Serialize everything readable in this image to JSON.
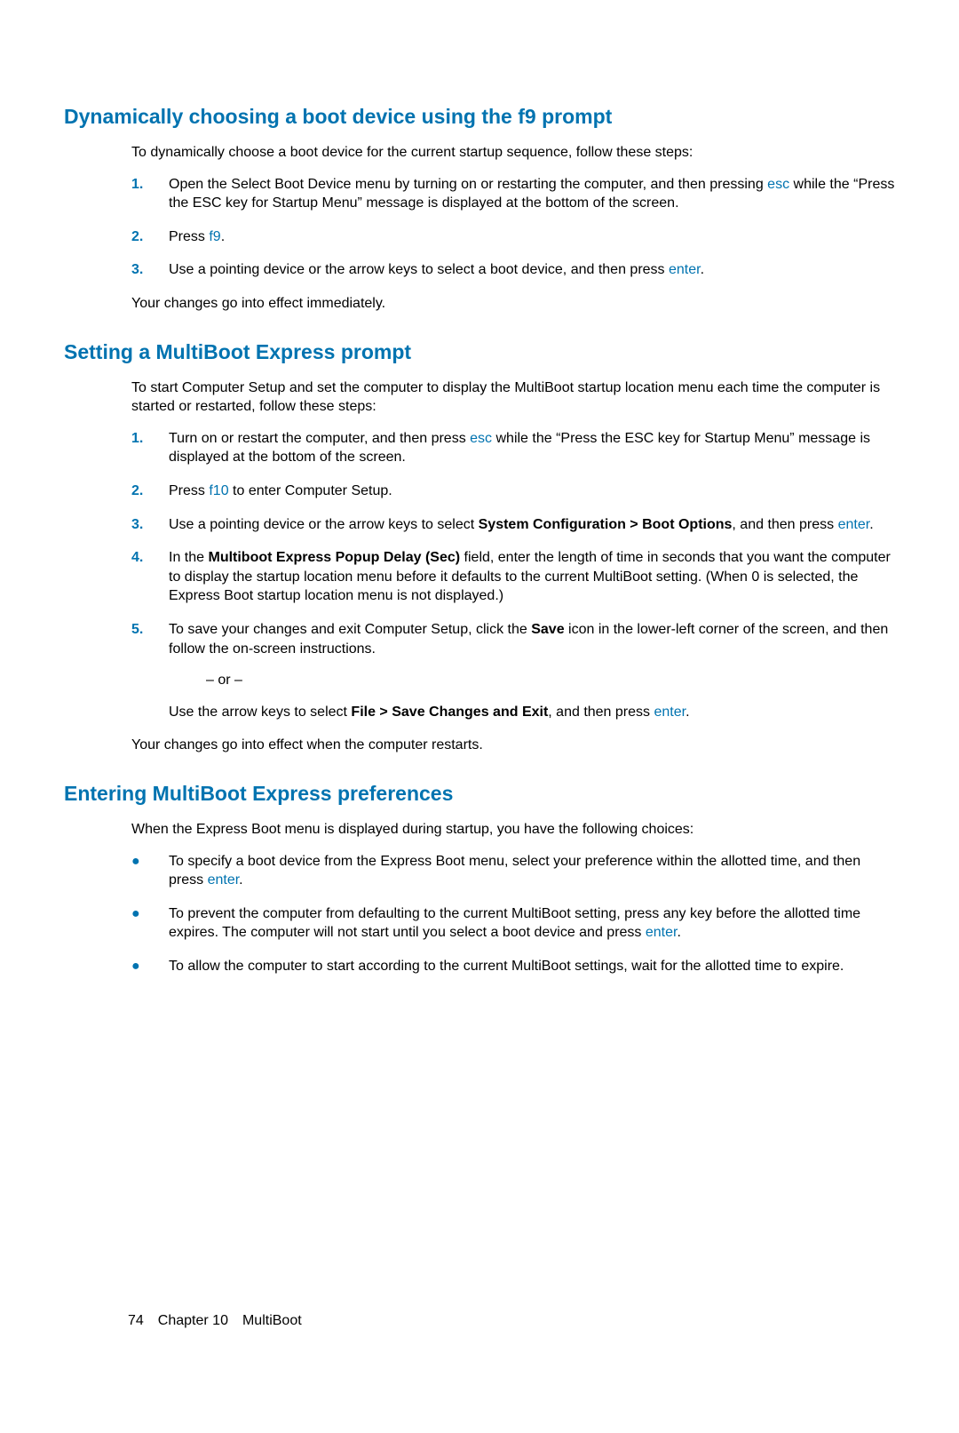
{
  "sections": {
    "s1": {
      "heading": "Dynamically choosing a boot device using the f9 prompt",
      "intro": "To dynamically choose a boot device for the current startup sequence, follow these steps:",
      "step1_a": "Open the Select Boot Device menu by turning on or restarting the computer, and then pressing ",
      "step1_key": "esc",
      "step1_b": " while the “Press the ESC key for Startup Menu” message is displayed at the bottom of the screen.",
      "step2_a": "Press ",
      "step2_key": "f9",
      "step2_b": ".",
      "step3_a": "Use a pointing device or the arrow keys to select a boot device, and then press ",
      "step3_key": "enter",
      "step3_b": ".",
      "outro": "Your changes go into effect immediately."
    },
    "s2": {
      "heading": "Setting a MultiBoot Express prompt",
      "intro": "To start Computer Setup and set the computer to display the MultiBoot startup location menu each time the computer is started or restarted, follow these steps:",
      "step1_a": "Turn on or restart the computer, and then press ",
      "step1_key": "esc",
      "step1_b": " while the “Press the ESC key for Startup Menu” message is displayed at the bottom of the screen.",
      "step2_a": "Press ",
      "step2_key": "f10",
      "step2_b": " to enter Computer Setup.",
      "step3_a": "Use a pointing device or the arrow keys to select ",
      "step3_bold": "System Configuration > Boot Options",
      "step3_b": ", and then press ",
      "step3_key": "enter",
      "step3_c": ".",
      "step4_a": "In the ",
      "step4_bold": "Multiboot Express Popup Delay (Sec)",
      "step4_b": " field, enter the length of time in seconds that you want the computer to display the startup location menu before it defaults to the current MultiBoot setting. (When 0 is selected, the Express Boot startup location menu is not displayed.)",
      "step5_a": "To save your changes and exit Computer Setup, click the ",
      "step5_bold1": "Save",
      "step5_b": " icon in the lower-left corner of the screen, and then follow the on-screen instructions.",
      "step5_or": "– or –",
      "step5_c": "Use the arrow keys to select ",
      "step5_bold2": "File > Save Changes and Exit",
      "step5_d": ", and then press ",
      "step5_key": "enter",
      "step5_e": ".",
      "outro": "Your changes go into effect when the computer restarts."
    },
    "s3": {
      "heading": "Entering MultiBoot Express preferences",
      "intro": "When the Express Boot menu is displayed during startup, you have the following choices:",
      "b1_a": "To specify a boot device from the Express Boot menu, select your preference within the allotted time, and then press ",
      "b1_key": "enter",
      "b1_b": ".",
      "b2_a": "To prevent the computer from defaulting to the current MultiBoot setting, press any key before the allotted time expires. The computer will not start until you select a boot device and press ",
      "b2_key": "enter",
      "b2_b": ".",
      "b3": "To allow the computer to start according to the current MultiBoot settings, wait for the allotted time to expire."
    }
  },
  "nums": {
    "n1": "1.",
    "n2": "2.",
    "n3": "3.",
    "n4": "4.",
    "n5": "5."
  },
  "bullet": "●",
  "footer": {
    "page": "74",
    "chapter": "Chapter 10 MultiBoot"
  }
}
